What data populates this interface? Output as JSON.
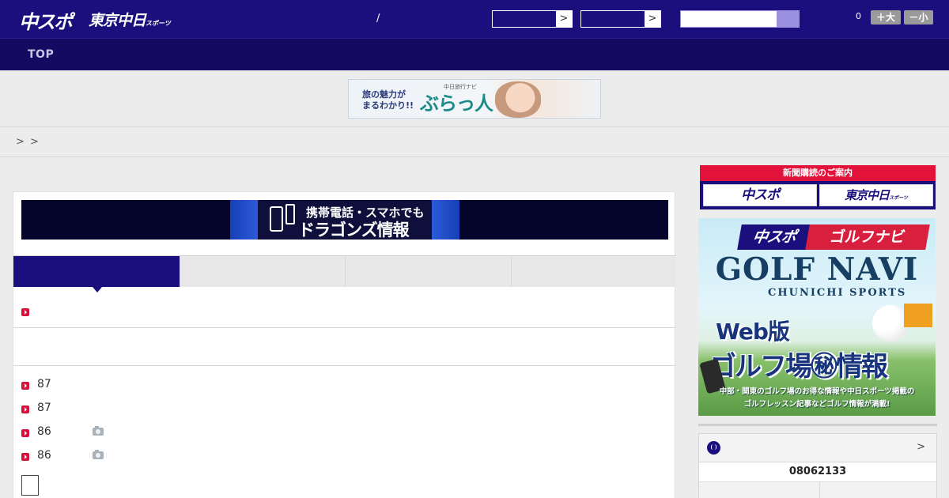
{
  "header": {
    "logo_main": "中スポ",
    "logo_tokyo": "東京中日",
    "logo_tokyo_suffix": "スポーツ",
    "separator": "/",
    "select_arrow": ">",
    "font_size_count": "0",
    "font_larger": "＋大",
    "font_smaller": "－小"
  },
  "nav": {
    "items": [
      {
        "label": "TOP"
      }
    ]
  },
  "ad_banner": {
    "line1": "旅の魅力が",
    "line2": "まるわかり!!",
    "sub": "中日旅行ナビ",
    "brand": "ぶらっ人"
  },
  "breadcrumb": {
    "sep1": ">",
    "sep2": ">"
  },
  "main": {
    "promo": {
      "line1": "携帯電話・スマホでも",
      "line2": "ドラゴンズ情報"
    },
    "list_items": [
      {
        "num": "87",
        "has_photo": false
      },
      {
        "num": "87",
        "has_photo": false
      },
      {
        "num": "86",
        "has_photo": true
      },
      {
        "num": "86",
        "has_photo": true
      }
    ]
  },
  "sidebar": {
    "subscribe_header": "新聞購読のご案内",
    "subscribe_chuspo": "中スポ",
    "subscribe_tokyo": "東京中日",
    "subscribe_tokyo_suffix": "スポーツ",
    "golf": {
      "badge1": "中スポ",
      "badge2": "ゴルフナビ",
      "title": "GOLF NAVI",
      "subtitle": "CHUNICHI SPORTS",
      "web": "Web版",
      "info": "ゴルフ場㊙情報",
      "footer1": "中部・関東のゴルフ場のお得な情報や中日スポーツ掲載の",
      "footer2": "ゴルフレッスン記事などゴルフ情報が満載!"
    },
    "baseball": {
      "arrow": ">",
      "date": "08062133"
    }
  },
  "colors": {
    "brand_navy": "#1b0f7d",
    "accent_red": "#d6123a"
  }
}
